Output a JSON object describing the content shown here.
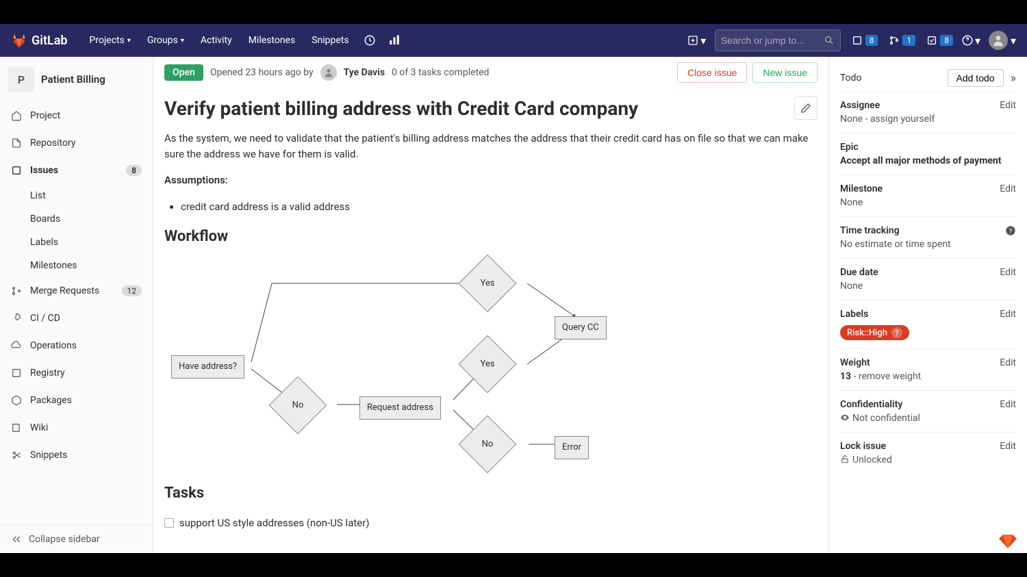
{
  "topnav": {
    "brand": "GitLab",
    "items": [
      "Projects",
      "Groups",
      "Activity",
      "Milestones",
      "Snippets"
    ],
    "search_placeholder": "Search or jump to...",
    "counts": {
      "issues": "8",
      "mrs": "1",
      "todos": "8"
    }
  },
  "project": {
    "avatar_letter": "P",
    "name": "Patient Billing"
  },
  "sidebar": {
    "items": [
      {
        "label": "Project"
      },
      {
        "label": "Repository"
      },
      {
        "label": "Issues",
        "badge": "8",
        "active": true
      },
      {
        "label": "Merge Requests",
        "badge": "12"
      },
      {
        "label": "CI / CD"
      },
      {
        "label": "Operations"
      },
      {
        "label": "Registry"
      },
      {
        "label": "Packages"
      },
      {
        "label": "Wiki"
      },
      {
        "label": "Snippets"
      }
    ],
    "issues_sub": [
      "List",
      "Boards",
      "Labels",
      "Milestones"
    ],
    "collapse": "Collapse sidebar"
  },
  "issue": {
    "status": "Open",
    "opened": "Opened 23 hours ago by",
    "author": "Tye Davis",
    "tasks_progress": "0 of 3 tasks completed",
    "close_btn": "Close issue",
    "new_btn": "New issue",
    "title": "Verify patient billing address with Credit Card company",
    "desc_p1": "As the system, we need to validate that the patient's billing address matches the address that their credit card has on file so that we can make sure the address we have for them is valid.",
    "assumptions_h": "Assumptions:",
    "assumption_1": "credit card address is a valid address",
    "workflow_h": "Workflow",
    "tasks_h": "Tasks",
    "task_1": "support US style addresses (non-US later)"
  },
  "diagram": {
    "have_address": "Have address?",
    "yes": "Yes",
    "no": "No",
    "request": "Request address",
    "query": "Query CC",
    "error": "Error"
  },
  "right": {
    "todo": "Todo",
    "add_todo": "Add todo",
    "assignee_h": "Assignee",
    "assignee_v": "None - assign yourself",
    "epic_h": "Epic",
    "epic_v": "Accept all major methods of payment",
    "milestone_h": "Milestone",
    "milestone_v": "None",
    "timetrack_h": "Time tracking",
    "timetrack_v": "No estimate or time spent",
    "duedate_h": "Due date",
    "duedate_v": "None",
    "labels_h": "Labels",
    "label_pill": "Risk::High",
    "weight_h": "Weight",
    "weight_v": "13",
    "weight_remove": " - remove weight",
    "conf_h": "Confidentiality",
    "conf_v": "Not confidential",
    "lock_h": "Lock issue",
    "lock_v": "Unlocked",
    "edit": "Edit"
  }
}
